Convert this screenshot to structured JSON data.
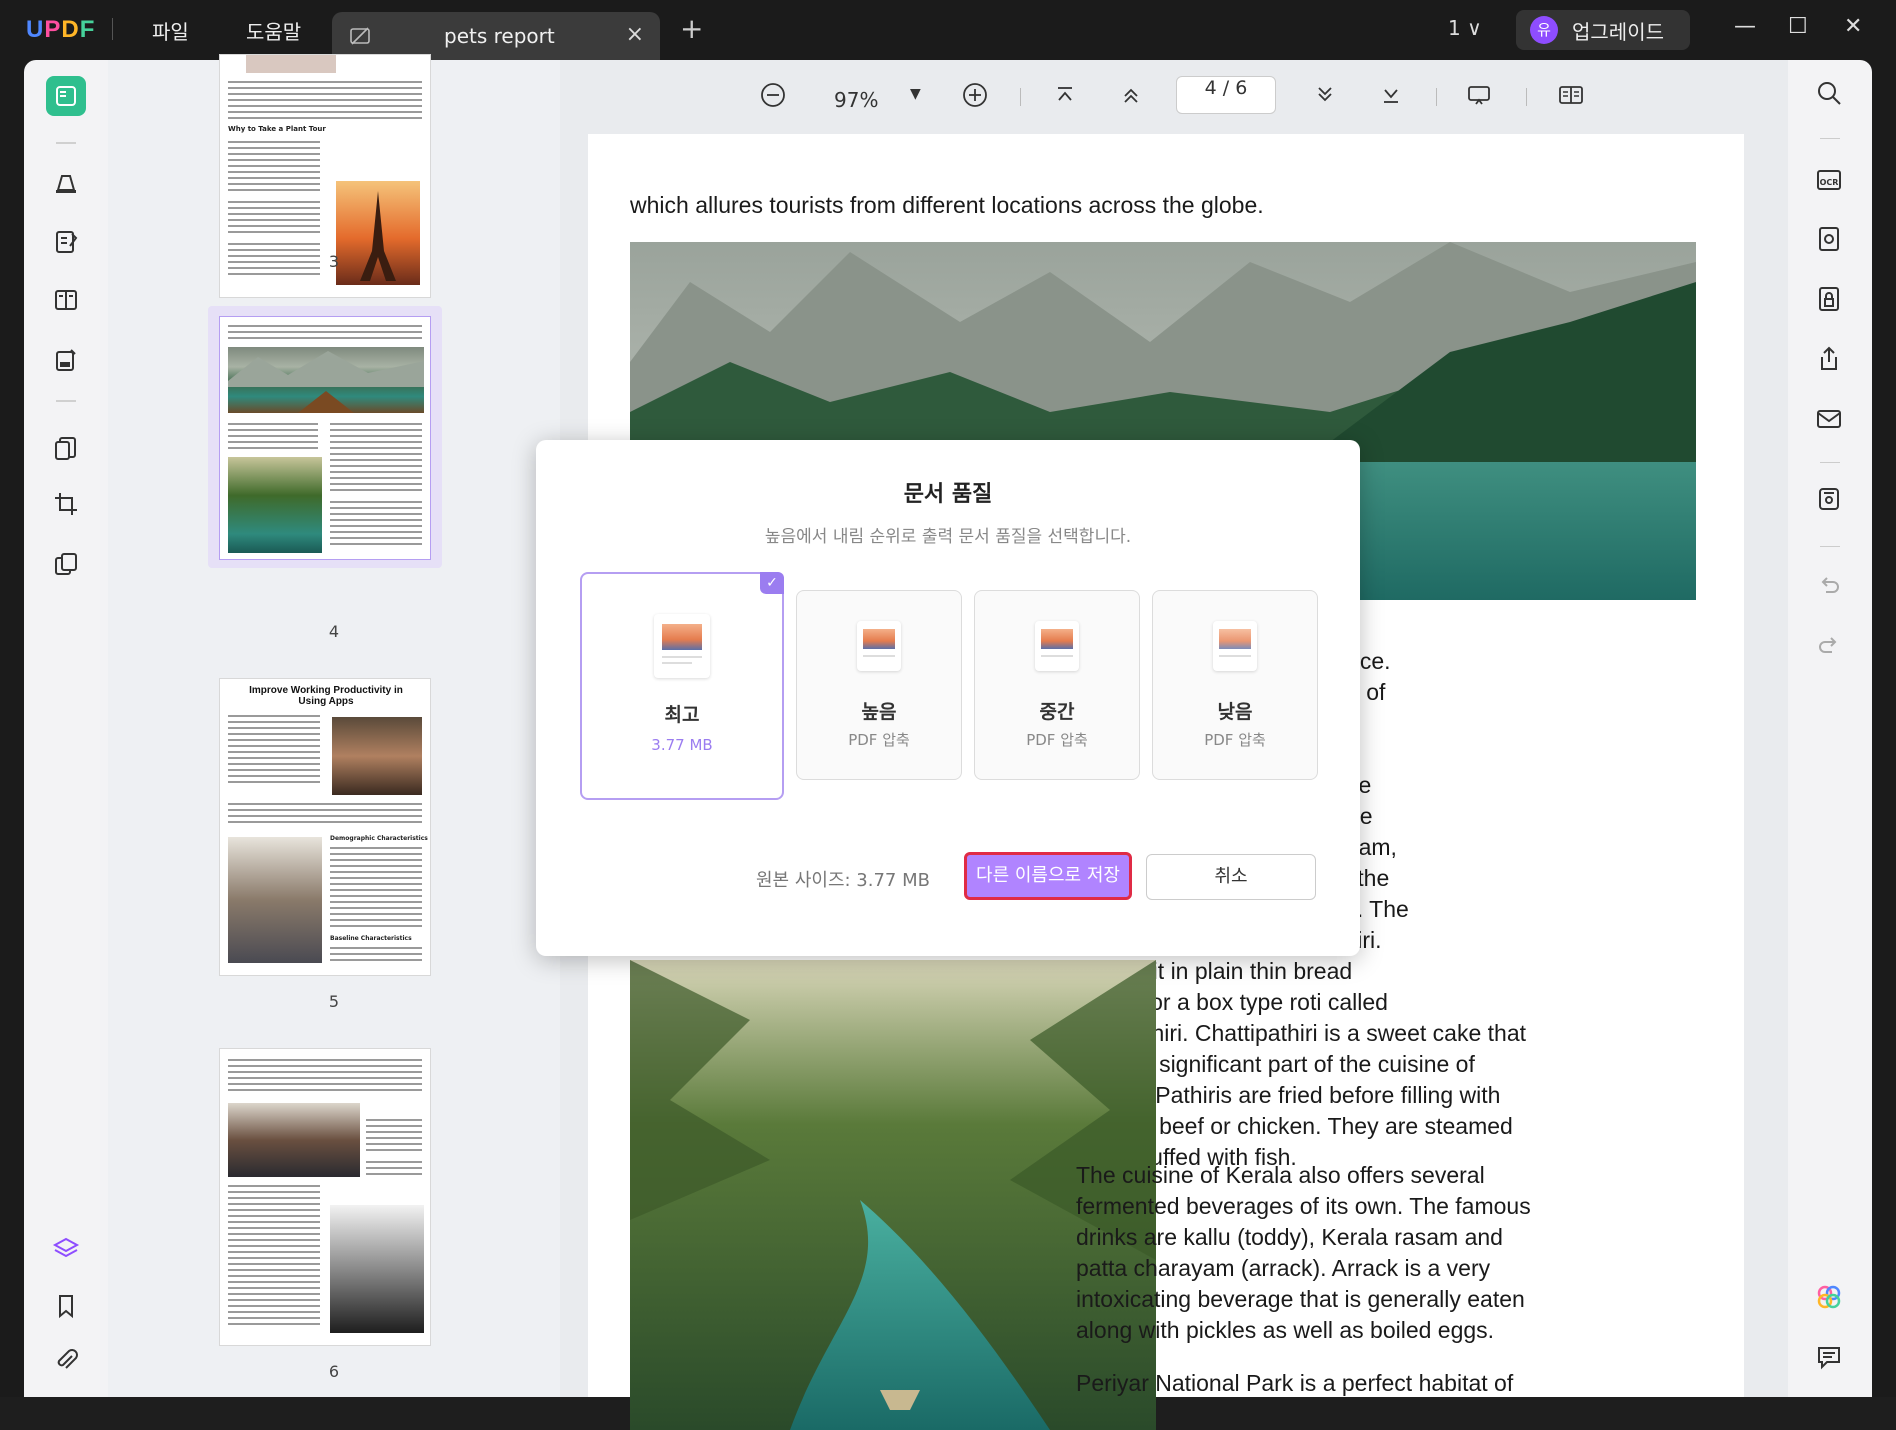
{
  "titlebar": {
    "logo": "UPDF",
    "menu": [
      "파일",
      "도움말"
    ],
    "tab_name": "pets report",
    "tab_close": "×",
    "new_tab": "+",
    "page_selector": "1 ∨",
    "user_initial": "유",
    "upgrade_label": "업그레이드",
    "window_controls": [
      "—",
      "☐",
      "✕"
    ]
  },
  "toolbar": {
    "zoom": "97%",
    "page_indicator": "4 / 6"
  },
  "thumbnails": {
    "page_numbers": [
      "3",
      "4",
      "5",
      "6"
    ],
    "page5_title": "Improve Working Productivity in Using Apps",
    "page3_heading": "Why to Take a Plant Tour",
    "page5_subheadings": [
      "Demographic Characteristics",
      "Baseline Characteristics"
    ]
  },
  "document": {
    "line_top": "which allures tourists from different locations across the globe.",
    "para1": [
      "od of Kerala is unpolished rice.",
      "boiled rice, there is an array of",
      "e  of  cereal  that  Keralites",
      "e common ones include the",
      "med  puttu,  the  noodles-like",
      "e lace rimmed palappam, the",
      "ppam the spongy vattayappam,",
      "resembling kallappam, and the",
      "ke kozhikotta. This is not all. The",
      "l in Kerala is called the pathiri.",
      "nsform it in plain thin bread",
      "ipathiri or a box type roti called",
      "pettipathiri. Chattipathiri is a sweet cake that",
      "forms a significant part of the cuisine of",
      "Kerala. Pathiris are fried before filling with",
      "mutton, beef or chicken. They are steamed",
      "once stuffed with fish."
    ],
    "para2": [
      "The cuisine of Kerala also offers several",
      "fermented beverages of its own. The famous",
      "drinks are kallu (toddy), Kerala rasam and",
      "patta charayam (arrack). Arrack is a very",
      "intoxicating beverage that is generally eaten",
      "along with pickles as well as boiled eggs."
    ],
    "line_bottom": "Periyar National Park is a perfect habitat of"
  },
  "dialog": {
    "title": "문서 품질",
    "subtitle": "높음에서 내림 순위로 출력 문서 품질을 선택합니다.",
    "options": [
      {
        "name": "최고",
        "detail": "3.77 MB"
      },
      {
        "name": "높음",
        "detail": "PDF 압축"
      },
      {
        "name": "중간",
        "detail": "PDF 압축"
      },
      {
        "name": "낮음",
        "detail": "PDF 압축"
      }
    ],
    "original_size": "원본 사이즈: 3.77 MB",
    "save_as": "다른 이름으로 저장",
    "cancel": "취소"
  },
  "colors": {
    "accent": "#b084ff",
    "selected_border": "#b59ef2",
    "highlight_red": "#e02b45",
    "sidebar_active": "#2fbf8e"
  },
  "icons": {
    "left_sidebar": [
      "reader-icon",
      "comment-icon",
      "edit-icon",
      "organize-icon",
      "form-icon",
      "convert-icon",
      "crop-icon",
      "compare-icon",
      "layers-icon",
      "bookmark-icon",
      "attachment-icon"
    ],
    "right_sidebar": [
      "search-icon",
      "ocr-icon",
      "convert-pdf-icon",
      "protect-icon",
      "share-icon",
      "email-icon",
      "save-icon",
      "undo-icon",
      "redo-icon",
      "ai-icon",
      "chat-icon"
    ]
  }
}
